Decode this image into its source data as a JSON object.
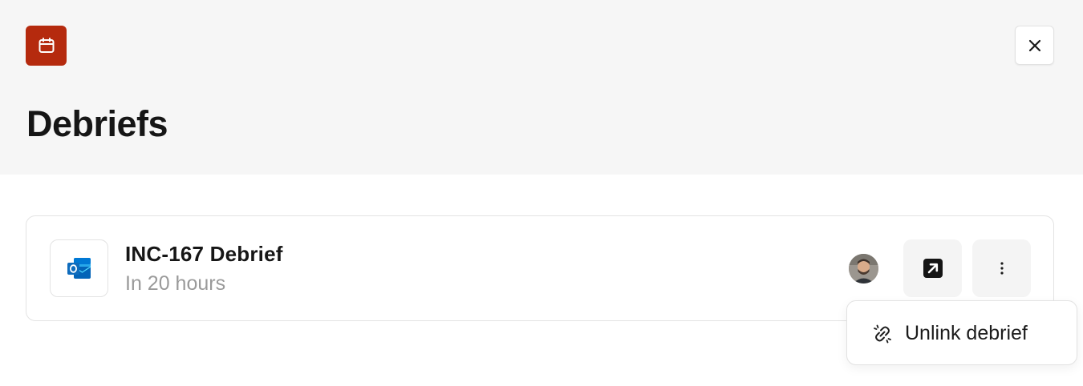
{
  "header": {
    "app_icon": "calendar-icon",
    "title": "Debriefs",
    "close_icon": "close-icon"
  },
  "debrief_item": {
    "provider_icon": "outlook-icon",
    "title": "INC-167 Debrief",
    "time": "In 20 hours",
    "avatar": "user-avatar",
    "open_icon": "open-external-arrow-icon",
    "more_icon": "more-vertical-icon"
  },
  "menu": {
    "items": [
      {
        "icon": "unlink-icon",
        "label": "Unlink debrief"
      }
    ]
  },
  "colors": {
    "header_bg": "#f6f6f6",
    "brand_badge": "#b52a0e",
    "subtitle_text": "#9a9a9a",
    "button_bg": "#f4f4f4",
    "outlook_blue": "#0f6cbd"
  }
}
